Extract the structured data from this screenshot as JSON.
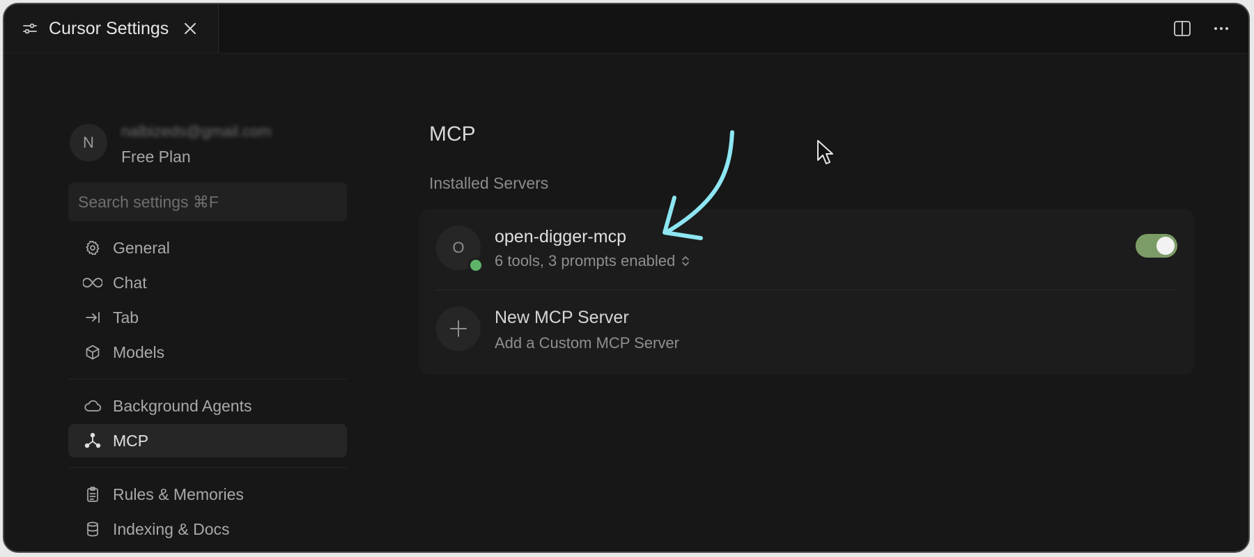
{
  "tab": {
    "title": "Cursor Settings"
  },
  "account": {
    "initial": "N",
    "email": "nalbizeds@gmail.com",
    "plan": "Free Plan"
  },
  "search": {
    "placeholder": "Search settings ⌘F"
  },
  "nav": {
    "group1": [
      {
        "label": "General",
        "icon": "gear-icon"
      },
      {
        "label": "Chat",
        "icon": "infinity-icon"
      },
      {
        "label": "Tab",
        "icon": "tab-arrow-icon"
      },
      {
        "label": "Models",
        "icon": "cube-icon"
      }
    ],
    "group2": [
      {
        "label": "Background Agents",
        "icon": "cloud-icon"
      },
      {
        "label": "MCP",
        "icon": "mcp-nodes-icon",
        "active": true
      }
    ],
    "group3": [
      {
        "label": "Rules & Memories",
        "icon": "clipboard-icon"
      },
      {
        "label": "Indexing & Docs",
        "icon": "database-icon"
      }
    ]
  },
  "main": {
    "title": "MCP",
    "section": "Installed Servers",
    "servers": [
      {
        "initial": "O",
        "name": "open-digger-mcp",
        "summary": "6 tools, 3 prompts enabled",
        "enabled": true,
        "status_color": "#5fb46a"
      }
    ],
    "new_server": {
      "title": "New MCP Server",
      "subtitle": "Add a Custom MCP Server"
    }
  },
  "colors": {
    "toggle_on": "#7c9c67",
    "annotation": "#8de6f2",
    "status_ok": "#5fb46a"
  }
}
